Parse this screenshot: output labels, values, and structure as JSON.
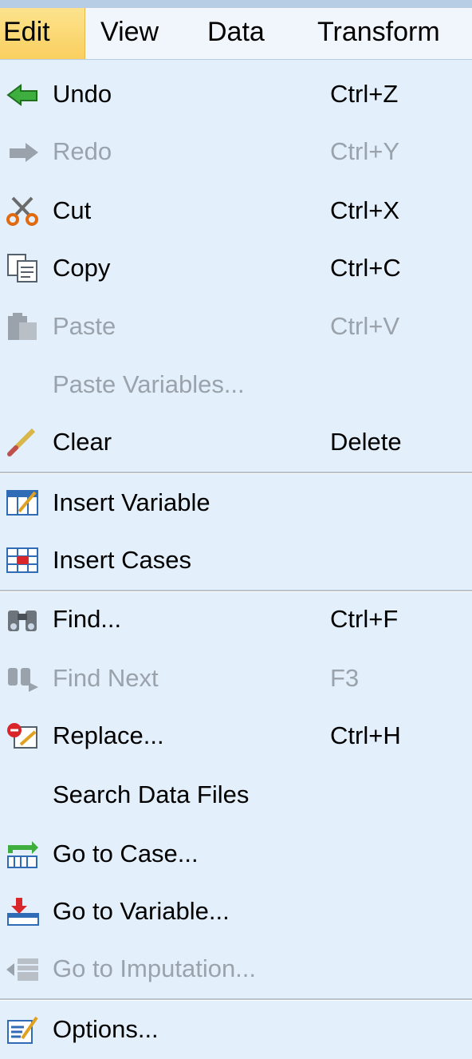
{
  "menubar": {
    "items": [
      {
        "label": "Edit",
        "active": true
      },
      {
        "label": "View"
      },
      {
        "label": "Data"
      },
      {
        "label": "Transform"
      }
    ]
  },
  "menu": {
    "items": [
      {
        "label": "Undo",
        "shortcut": "Ctrl+Z",
        "icon": "undo-icon",
        "enabled": true
      },
      {
        "label": "Redo",
        "shortcut": "Ctrl+Y",
        "icon": "redo-icon",
        "enabled": false
      },
      {
        "label": "Cut",
        "shortcut": "Ctrl+X",
        "icon": "scissors-icon",
        "enabled": true
      },
      {
        "label": "Copy",
        "shortcut": "Ctrl+C",
        "icon": "copy-icon",
        "enabled": true
      },
      {
        "label": "Paste",
        "shortcut": "Ctrl+V",
        "icon": "paste-icon",
        "enabled": false
      },
      {
        "label": "Paste Variables...",
        "shortcut": "",
        "icon": "",
        "enabled": false
      },
      {
        "label": "Clear",
        "shortcut": "Delete",
        "icon": "eraser-icon",
        "enabled": true
      },
      {
        "label": "Insert Variable",
        "shortcut": "",
        "icon": "insert-variable-icon",
        "enabled": true
      },
      {
        "label": "Insert Cases",
        "shortcut": "",
        "icon": "insert-cases-icon",
        "enabled": true
      },
      {
        "label": "Find...",
        "shortcut": "Ctrl+F",
        "icon": "binoculars-icon",
        "enabled": true
      },
      {
        "label": "Find Next",
        "shortcut": "F3",
        "icon": "find-next-icon",
        "enabled": false
      },
      {
        "label": "Replace...",
        "shortcut": "Ctrl+H",
        "icon": "replace-icon",
        "enabled": true
      },
      {
        "label": "Search Data Files",
        "shortcut": "",
        "icon": "",
        "enabled": true
      },
      {
        "label": "Go to Case...",
        "shortcut": "",
        "icon": "go-to-case-icon",
        "enabled": true
      },
      {
        "label": "Go to Variable...",
        "shortcut": "",
        "icon": "go-to-variable-icon",
        "enabled": true
      },
      {
        "label": "Go to Imputation...",
        "shortcut": "",
        "icon": "go-to-imputation-icon",
        "enabled": false
      },
      {
        "label": "Options...",
        "shortcut": "",
        "icon": "options-icon",
        "enabled": true
      }
    ]
  },
  "colors": {
    "menu_background": "#e3effb",
    "active_menu_highlight": "#fbd979",
    "disabled_text": "#9aa2ab"
  }
}
